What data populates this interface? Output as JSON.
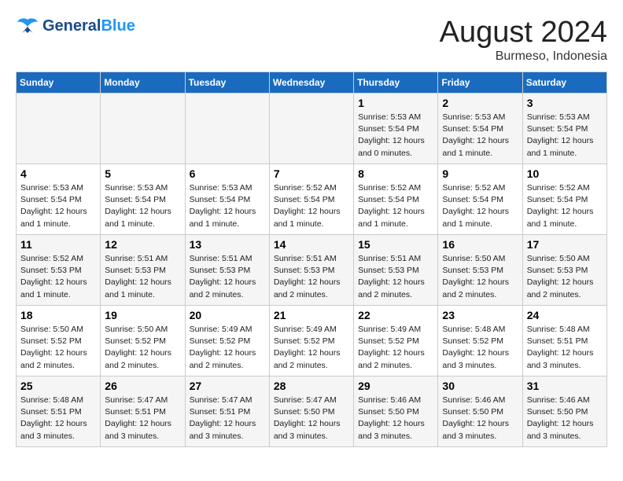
{
  "header": {
    "logo_line1": "General",
    "logo_line2": "Blue",
    "month": "August 2024",
    "location": "Burmeso, Indonesia"
  },
  "weekdays": [
    "Sunday",
    "Monday",
    "Tuesday",
    "Wednesday",
    "Thursday",
    "Friday",
    "Saturday"
  ],
  "weeks": [
    [
      {
        "day": "",
        "info": ""
      },
      {
        "day": "",
        "info": ""
      },
      {
        "day": "",
        "info": ""
      },
      {
        "day": "",
        "info": ""
      },
      {
        "day": "1",
        "info": "Sunrise: 5:53 AM\nSunset: 5:54 PM\nDaylight: 12 hours\nand 0 minutes."
      },
      {
        "day": "2",
        "info": "Sunrise: 5:53 AM\nSunset: 5:54 PM\nDaylight: 12 hours\nand 1 minute."
      },
      {
        "day": "3",
        "info": "Sunrise: 5:53 AM\nSunset: 5:54 PM\nDaylight: 12 hours\nand 1 minute."
      }
    ],
    [
      {
        "day": "4",
        "info": "Sunrise: 5:53 AM\nSunset: 5:54 PM\nDaylight: 12 hours\nand 1 minute."
      },
      {
        "day": "5",
        "info": "Sunrise: 5:53 AM\nSunset: 5:54 PM\nDaylight: 12 hours\nand 1 minute."
      },
      {
        "day": "6",
        "info": "Sunrise: 5:53 AM\nSunset: 5:54 PM\nDaylight: 12 hours\nand 1 minute."
      },
      {
        "day": "7",
        "info": "Sunrise: 5:52 AM\nSunset: 5:54 PM\nDaylight: 12 hours\nand 1 minute."
      },
      {
        "day": "8",
        "info": "Sunrise: 5:52 AM\nSunset: 5:54 PM\nDaylight: 12 hours\nand 1 minute."
      },
      {
        "day": "9",
        "info": "Sunrise: 5:52 AM\nSunset: 5:54 PM\nDaylight: 12 hours\nand 1 minute."
      },
      {
        "day": "10",
        "info": "Sunrise: 5:52 AM\nSunset: 5:54 PM\nDaylight: 12 hours\nand 1 minute."
      }
    ],
    [
      {
        "day": "11",
        "info": "Sunrise: 5:52 AM\nSunset: 5:53 PM\nDaylight: 12 hours\nand 1 minute."
      },
      {
        "day": "12",
        "info": "Sunrise: 5:51 AM\nSunset: 5:53 PM\nDaylight: 12 hours\nand 1 minute."
      },
      {
        "day": "13",
        "info": "Sunrise: 5:51 AM\nSunset: 5:53 PM\nDaylight: 12 hours\nand 2 minutes."
      },
      {
        "day": "14",
        "info": "Sunrise: 5:51 AM\nSunset: 5:53 PM\nDaylight: 12 hours\nand 2 minutes."
      },
      {
        "day": "15",
        "info": "Sunrise: 5:51 AM\nSunset: 5:53 PM\nDaylight: 12 hours\nand 2 minutes."
      },
      {
        "day": "16",
        "info": "Sunrise: 5:50 AM\nSunset: 5:53 PM\nDaylight: 12 hours\nand 2 minutes."
      },
      {
        "day": "17",
        "info": "Sunrise: 5:50 AM\nSunset: 5:53 PM\nDaylight: 12 hours\nand 2 minutes."
      }
    ],
    [
      {
        "day": "18",
        "info": "Sunrise: 5:50 AM\nSunset: 5:52 PM\nDaylight: 12 hours\nand 2 minutes."
      },
      {
        "day": "19",
        "info": "Sunrise: 5:50 AM\nSunset: 5:52 PM\nDaylight: 12 hours\nand 2 minutes."
      },
      {
        "day": "20",
        "info": "Sunrise: 5:49 AM\nSunset: 5:52 PM\nDaylight: 12 hours\nand 2 minutes."
      },
      {
        "day": "21",
        "info": "Sunrise: 5:49 AM\nSunset: 5:52 PM\nDaylight: 12 hours\nand 2 minutes."
      },
      {
        "day": "22",
        "info": "Sunrise: 5:49 AM\nSunset: 5:52 PM\nDaylight: 12 hours\nand 2 minutes."
      },
      {
        "day": "23",
        "info": "Sunrise: 5:48 AM\nSunset: 5:52 PM\nDaylight: 12 hours\nand 3 minutes."
      },
      {
        "day": "24",
        "info": "Sunrise: 5:48 AM\nSunset: 5:51 PM\nDaylight: 12 hours\nand 3 minutes."
      }
    ],
    [
      {
        "day": "25",
        "info": "Sunrise: 5:48 AM\nSunset: 5:51 PM\nDaylight: 12 hours\nand 3 minutes."
      },
      {
        "day": "26",
        "info": "Sunrise: 5:47 AM\nSunset: 5:51 PM\nDaylight: 12 hours\nand 3 minutes."
      },
      {
        "day": "27",
        "info": "Sunrise: 5:47 AM\nSunset: 5:51 PM\nDaylight: 12 hours\nand 3 minutes."
      },
      {
        "day": "28",
        "info": "Sunrise: 5:47 AM\nSunset: 5:50 PM\nDaylight: 12 hours\nand 3 minutes."
      },
      {
        "day": "29",
        "info": "Sunrise: 5:46 AM\nSunset: 5:50 PM\nDaylight: 12 hours\nand 3 minutes."
      },
      {
        "day": "30",
        "info": "Sunrise: 5:46 AM\nSunset: 5:50 PM\nDaylight: 12 hours\nand 3 minutes."
      },
      {
        "day": "31",
        "info": "Sunrise: 5:46 AM\nSunset: 5:50 PM\nDaylight: 12 hours\nand 3 minutes."
      }
    ]
  ]
}
